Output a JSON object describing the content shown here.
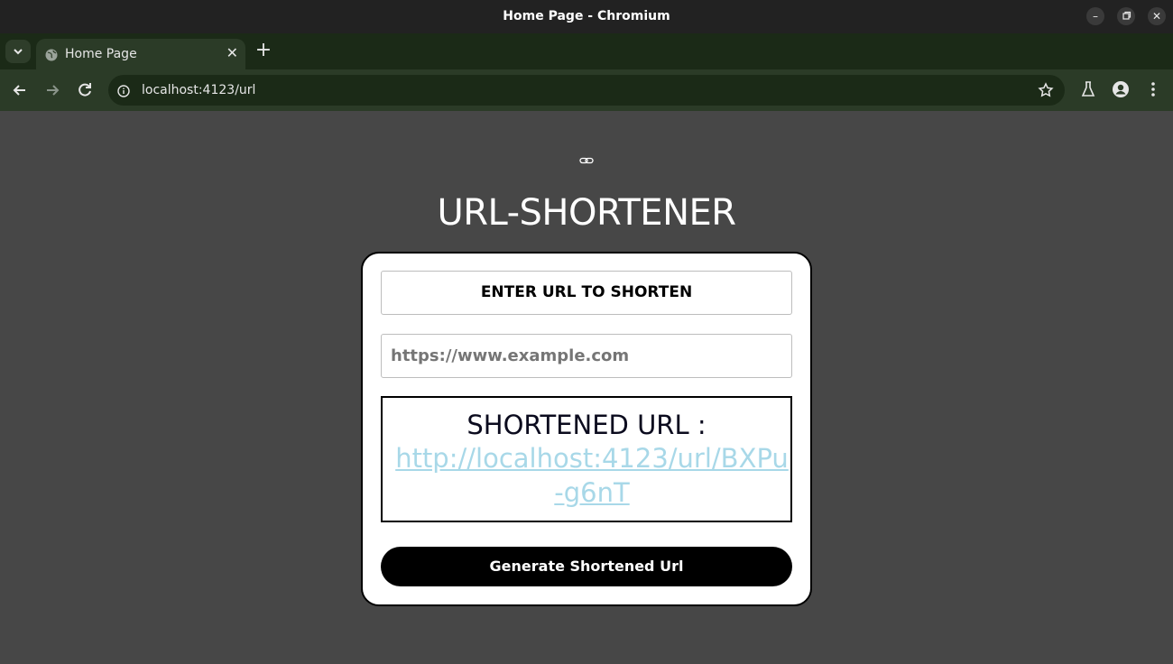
{
  "window": {
    "title": "Home Page - Chromium"
  },
  "tabs": [
    {
      "label": "Home Page",
      "active": true,
      "icon": "globe-icon"
    }
  ],
  "toolbar": {
    "url": "localhost:4123/url"
  },
  "page": {
    "heading": "URL-SHORTENER",
    "form_label": "ENTER URL TO SHORTEN",
    "input_placeholder": "https://www.example.com",
    "input_value": "",
    "result_label": "SHORTENED URL :",
    "result_link": "http://localhost:4123/url/BXPu-g6nT",
    "generate_button": "Generate Shortened Url"
  },
  "colors": {
    "page_background": "#474747",
    "link": "#a8d8e8",
    "button": "#000000",
    "tab_strip": "#1b2a17",
    "toolbar": "#2b3b27"
  }
}
